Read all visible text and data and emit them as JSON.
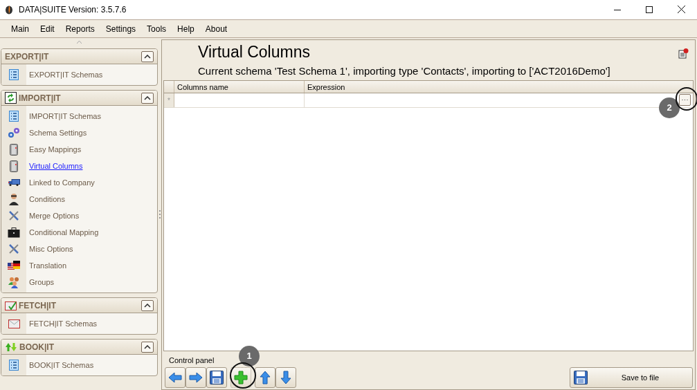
{
  "window": {
    "title": "DATA|SUITE Version: 3.5.7.6"
  },
  "menu": [
    "Main",
    "Edit",
    "Reports",
    "Settings",
    "Tools",
    "Help",
    "About"
  ],
  "sidebar": {
    "groups": [
      {
        "title": "EXPORT|IT",
        "items": [
          {
            "label": "EXPORT|IT Schemas",
            "selected": false
          }
        ]
      },
      {
        "title": "IMPORT|IT",
        "items": [
          {
            "label": "IMPORT|IT Schemas",
            "selected": false
          },
          {
            "label": "Schema Settings",
            "selected": false
          },
          {
            "label": "Easy Mappings",
            "selected": false
          },
          {
            "label": "Virtual Columns",
            "selected": true
          },
          {
            "label": "Linked to Company",
            "selected": false
          },
          {
            "label": "Conditions",
            "selected": false
          },
          {
            "label": "Merge Options",
            "selected": false
          },
          {
            "label": "Conditional Mapping",
            "selected": false
          },
          {
            "label": "Misc Options",
            "selected": false
          },
          {
            "label": "Translation",
            "selected": false
          },
          {
            "label": "Groups",
            "selected": false
          }
        ]
      },
      {
        "title": "FETCH|IT",
        "items": [
          {
            "label": "FETCH|IT Schemas",
            "selected": false
          }
        ]
      },
      {
        "title": "BOOK|IT",
        "items": [
          {
            "label": "BOOK|IT Schemas",
            "selected": false
          }
        ]
      }
    ]
  },
  "page": {
    "title": "Virtual Columns",
    "subtitle": "Current schema 'Test Schema 1', importing type 'Contacts', importing to ['ACT2016Demo']"
  },
  "table": {
    "columns": [
      "Columns name",
      "Expression"
    ],
    "new_row_marker": "*"
  },
  "control_panel": {
    "label": "Control panel",
    "save_button": "Save to file"
  },
  "callouts": [
    {
      "label": "1"
    },
    {
      "label": "2"
    }
  ]
}
